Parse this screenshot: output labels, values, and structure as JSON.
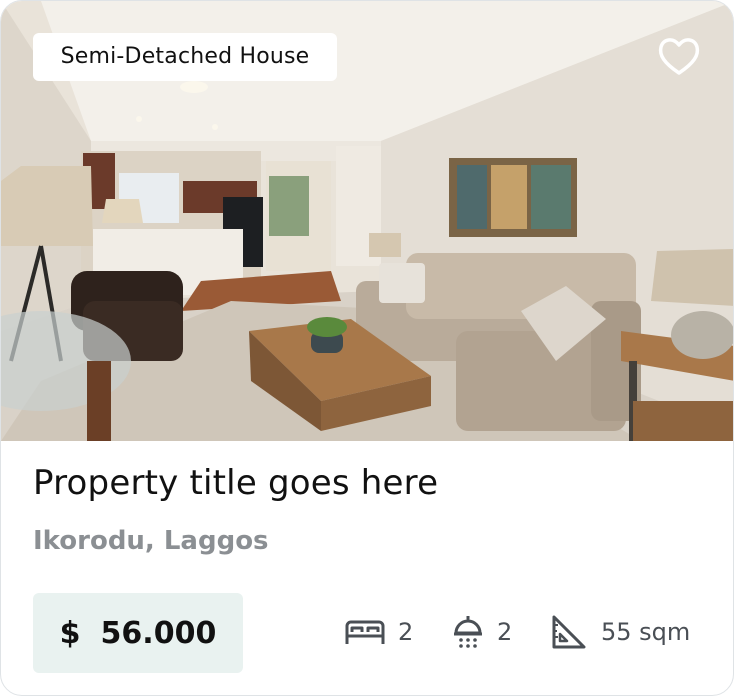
{
  "card": {
    "property_type": "Semi-Detached House",
    "title": "Property title goes here",
    "location": "Ikorodu, Laggos",
    "price": {
      "currency": "$",
      "amount": "56.000"
    },
    "features": {
      "bedrooms": "2",
      "bathrooms": "2",
      "area": "55 sqm"
    },
    "icons": {
      "favorite": "heart-outline-icon",
      "bedrooms": "bed-icon",
      "bathrooms": "shower-icon",
      "area": "set-square-icon"
    },
    "colors": {
      "price_background": "#e9f2f0",
      "location_text": "#8b8f93",
      "feature_text": "#4a4f55"
    }
  }
}
